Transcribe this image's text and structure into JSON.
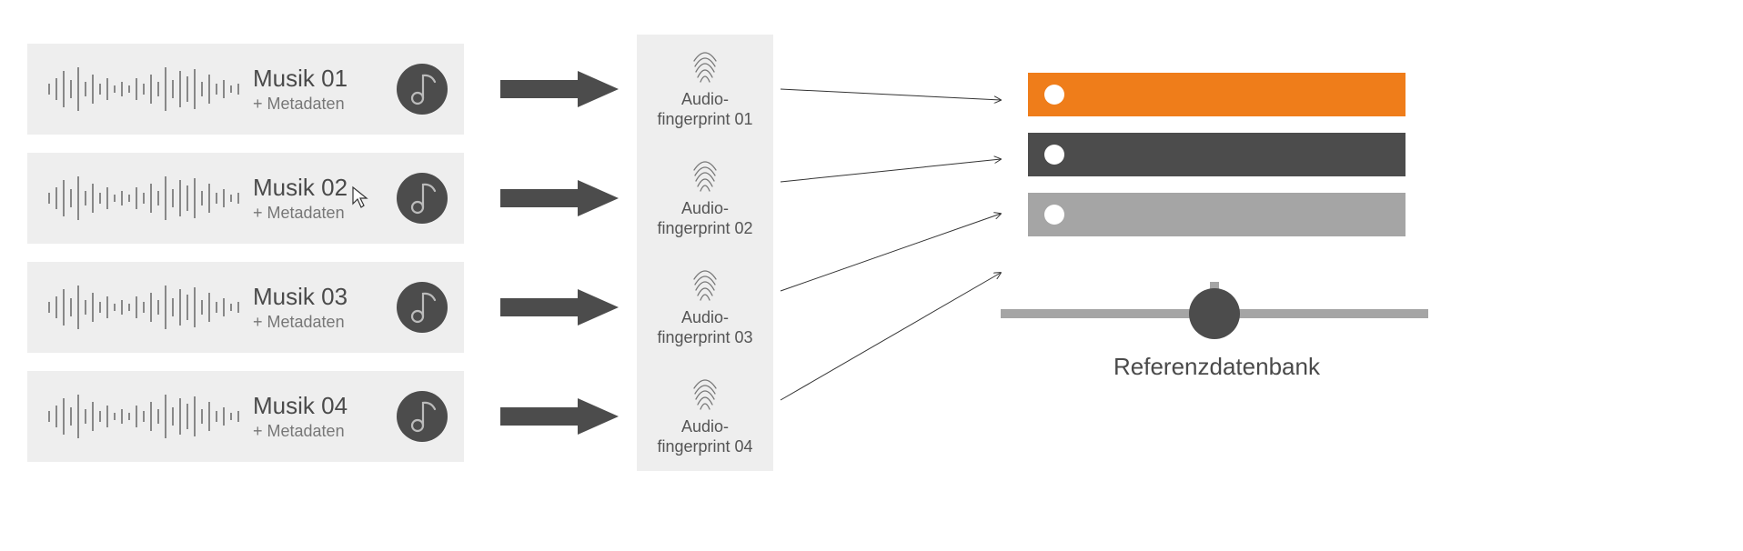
{
  "music_items": [
    {
      "title": "Musik 01",
      "sub": "+ Metadaten"
    },
    {
      "title": "Musik 02",
      "sub": "+ Metadaten"
    },
    {
      "title": "Musik 03",
      "sub": "+ Metadaten"
    },
    {
      "title": "Musik 04",
      "sub": "+ Metadaten"
    }
  ],
  "fingerprint_items": [
    {
      "line1": "Audio-",
      "line2": "fingerprint 01"
    },
    {
      "line1": "Audio-",
      "line2": "fingerprint 02"
    },
    {
      "line1": "Audio-",
      "line2": "fingerprint 03"
    },
    {
      "line1": "Audio-",
      "line2": "fingerprint 04"
    }
  ],
  "database_label": "Referenzdatenbank",
  "colors": {
    "accent": "#ef7d1a",
    "dark": "#4c4c4c",
    "grey": "#a5a5a5",
    "panel": "#eeeeee"
  }
}
